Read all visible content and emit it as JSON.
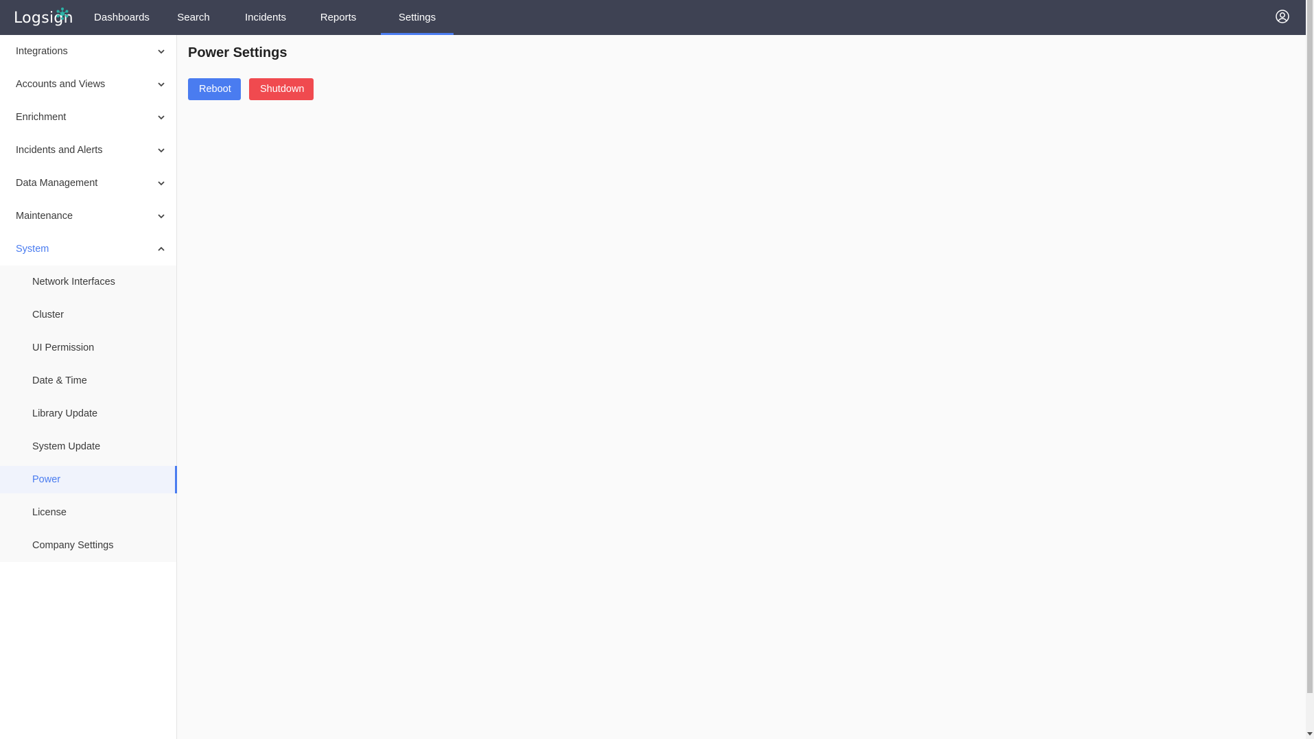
{
  "app": {
    "logo_text": "Logsign",
    "colors": {
      "topbar": "#3e4253",
      "accent": "#4a7cf0",
      "danger": "#f04a4f",
      "logo_mark": "#2ab3a6"
    }
  },
  "nav": {
    "items": [
      {
        "label": "Dashboards"
      },
      {
        "label": "Search"
      },
      {
        "label": "Incidents"
      },
      {
        "label": "Reports"
      },
      {
        "label": "Settings"
      }
    ],
    "active": "Settings",
    "user_icon": "user-circle-icon"
  },
  "sidebar": {
    "groups": [
      {
        "label": "Integrations",
        "icon": "chevron-down-icon"
      },
      {
        "label": "Accounts and Views",
        "icon": "chevron-down-icon"
      },
      {
        "label": "Enrichment",
        "icon": "chevron-down-icon"
      },
      {
        "label": "Incidents and Alerts",
        "icon": "chevron-down-icon"
      },
      {
        "label": "Data Management",
        "icon": "chevron-down-icon"
      },
      {
        "label": "Maintenance",
        "icon": "chevron-down-icon"
      },
      {
        "label": "System",
        "icon": "chevron-up-icon"
      }
    ],
    "system_items": [
      {
        "label": "Network Interfaces"
      },
      {
        "label": "Cluster"
      },
      {
        "label": "UI Permission"
      },
      {
        "label": "Date & Time"
      },
      {
        "label": "Library Update"
      },
      {
        "label": "System Update"
      },
      {
        "label": "Power"
      },
      {
        "label": "License"
      },
      {
        "label": "Company Settings"
      }
    ],
    "active_item": "Power"
  },
  "main": {
    "title": "Power Settings",
    "reboot_label": "Reboot",
    "shutdown_label": "Shutdown"
  }
}
